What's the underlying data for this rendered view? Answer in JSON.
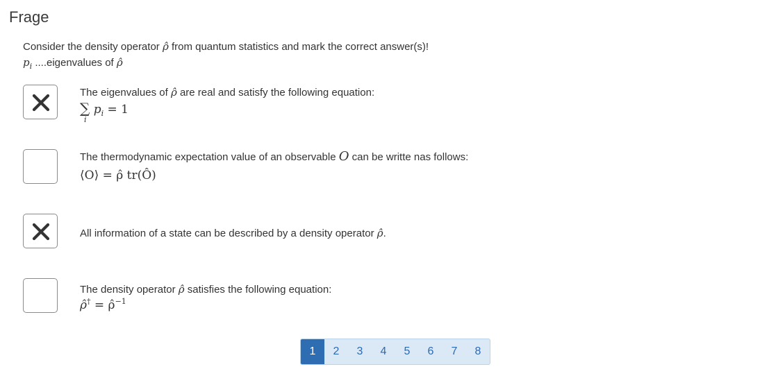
{
  "heading": "Frage",
  "question": {
    "line1_prefix": "Consider the density operator",
    "line1_symbol": "ρ̂",
    "line1_suffix": "from quantum statistics and mark the correct answer(s)!",
    "line2_symbol": "p",
    "line2_sub": "i",
    "line2_text": "....eigenvalues of",
    "line2_symbol2": "ρ̂"
  },
  "options": [
    {
      "checked": true,
      "text_before": "The eigenvalues of",
      "symbol": "ρ̂",
      "text_after": "are real and satisfy the following equation:",
      "formula_sum": "∑",
      "formula_var": "p",
      "formula_sub": "i",
      "formula_eq": "= 1",
      "formula_under": "i"
    },
    {
      "checked": false,
      "text_before": "The thermodynamic expectation value of an observable",
      "symbol": "O",
      "text_after": "can be writte nas follows:",
      "formula": "⟨O⟩ = ρ̂ tr(Ô)"
    },
    {
      "checked": true,
      "text_before": "All information of a state can be described by a density operator",
      "symbol": "ρ̂",
      "text_after": "."
    },
    {
      "checked": false,
      "text_before": "The density operator",
      "symbol": "ρ̂",
      "text_after": "satisfies the following equation:",
      "formula_lhs": "ρ̂",
      "formula_lhs_sup": "†",
      "formula_eq": "= ρ̂",
      "formula_rhs_sup": "−1"
    }
  ],
  "pagination": {
    "pages": [
      "1",
      "2",
      "3",
      "4",
      "5",
      "6",
      "7",
      "8"
    ],
    "active": "1"
  },
  "colors": {
    "active_page": "#2f6db3",
    "pager_bg": "#dbe8f5",
    "page_text": "#2c6bb3"
  },
  "icons": {
    "checked": "close-x-icon"
  }
}
